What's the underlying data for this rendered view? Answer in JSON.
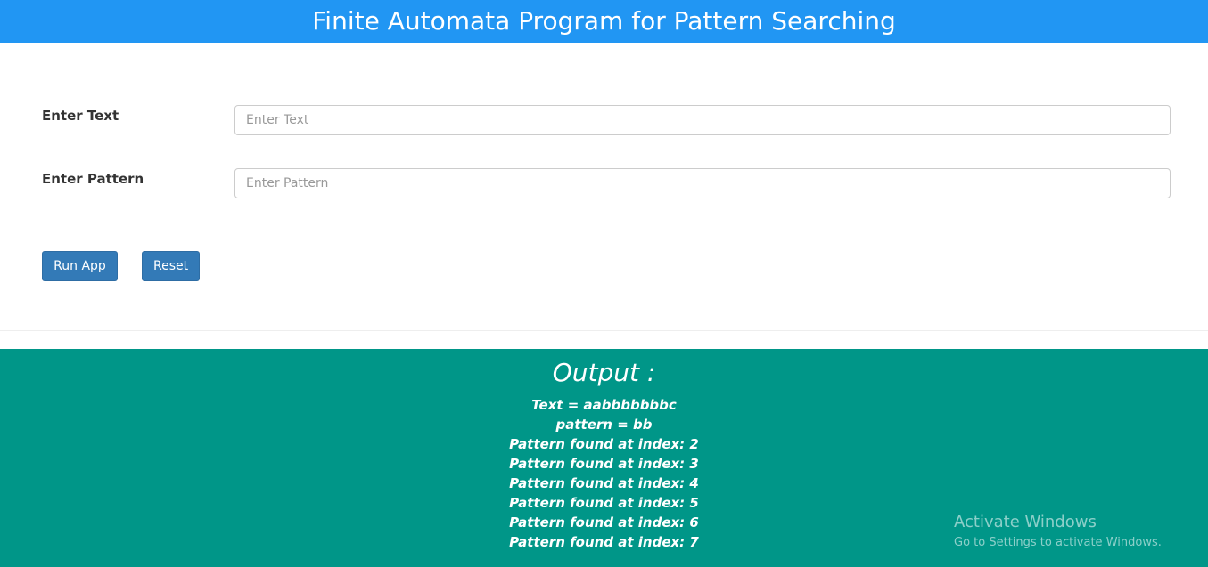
{
  "header": {
    "title": "Finite Automata Program for Pattern Searching"
  },
  "form": {
    "text_label": "Enter Text",
    "text_placeholder": "Enter Text",
    "text_value": "",
    "pattern_label": "Enter Pattern",
    "pattern_placeholder": "Enter Pattern",
    "pattern_value": "",
    "run_label": "Run App",
    "reset_label": "Reset"
  },
  "output": {
    "title": "Output :",
    "lines": [
      "Text = aabbbbbbbc",
      "pattern = bb",
      "Pattern found at index: 2",
      "Pattern found at index: 3",
      "Pattern found at index: 4",
      "Pattern found at index: 5",
      "Pattern found at index: 6",
      "Pattern found at index: 7"
    ]
  },
  "watermark": {
    "title": "Activate Windows",
    "subtitle": "Go to Settings to activate Windows."
  },
  "colors": {
    "header_bg": "#2196f3",
    "output_bg": "#009688",
    "button_bg": "#337ab7"
  }
}
